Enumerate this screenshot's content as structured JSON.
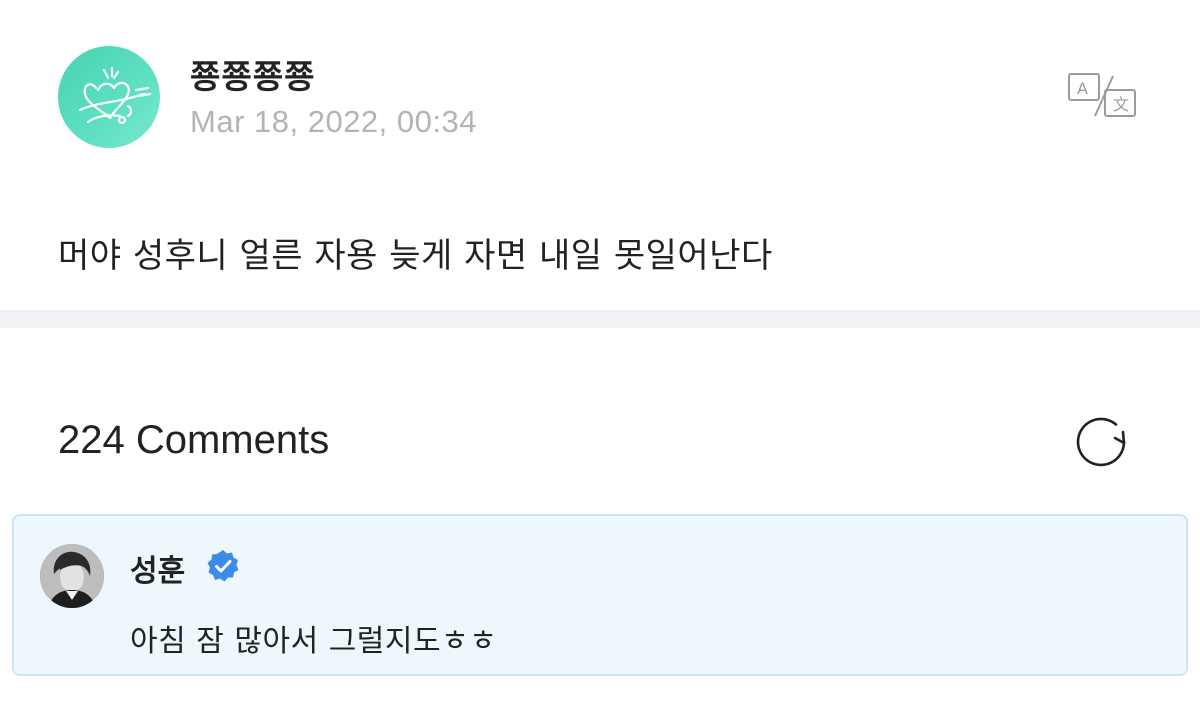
{
  "post": {
    "author": "쭁쭁쭁쭁",
    "date": "Mar 18, 2022, 00:34",
    "body": "머야 성후니 얼른 자용 늦게 자면 내일 못일어난다",
    "translate_icon": "translate-icon",
    "avatar_icon": "heart-doodle-icon"
  },
  "comments": {
    "count_label": "224 Comments",
    "refresh_icon": "refresh-icon",
    "items": [
      {
        "name": "성훈",
        "verified": true,
        "text": "아침 잠 많아서 그럴지도ㅎㅎ"
      }
    ]
  },
  "colors": {
    "avatar_green": "#45d3b0",
    "date_gray": "#b3b3b8",
    "verified_blue": "#3d8be8",
    "comment_bg": "#eef8fc",
    "comment_border": "#c9e6ef",
    "divider": "#f2f2f6"
  }
}
